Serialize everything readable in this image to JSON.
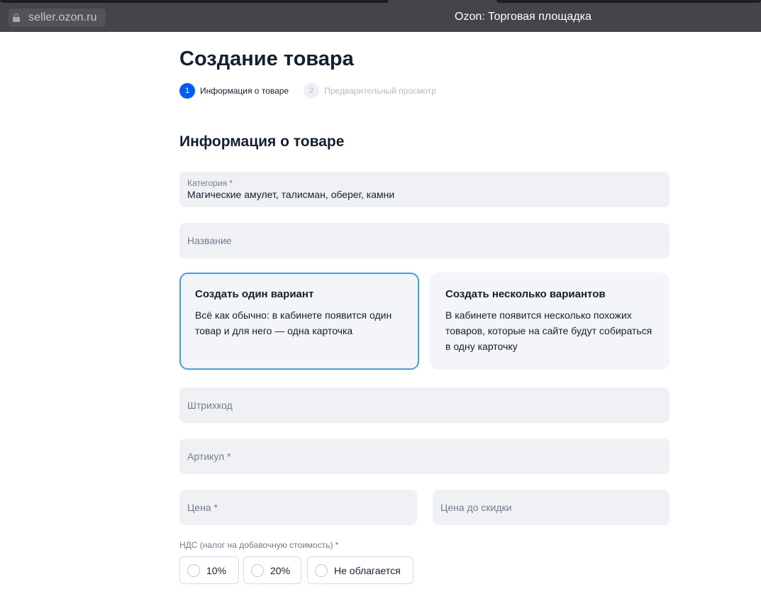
{
  "browser": {
    "url": "seller.ozon.ru",
    "window_title": "Ozon: Торговая площадка"
  },
  "page": {
    "title": "Создание товара",
    "steps": [
      {
        "number": "1",
        "label": "Информация о товаре",
        "active": true
      },
      {
        "number": "2",
        "label": "Предварительный просмотр",
        "active": false
      }
    ],
    "section_title": "Информация о товаре"
  },
  "form": {
    "category": {
      "label": "Категория *",
      "value": "Магические амулет, талисман, оберег, камни"
    },
    "name": {
      "placeholder": "Название"
    },
    "variants": [
      {
        "title": "Создать один вариант",
        "description": "Всё как обычно: в кабинете появится один товар и для него — одна карточка",
        "selected": true
      },
      {
        "title": "Создать несколько вариантов",
        "description": "В кабинете появится несколько похожих товаров, которые на сайте будут собираться в одну карточку",
        "selected": false
      }
    ],
    "barcode": {
      "placeholder": "Штрихкод"
    },
    "article": {
      "placeholder": "Артикул *"
    },
    "price": {
      "placeholder": "Цена *"
    },
    "old_price": {
      "placeholder": "Цена до скидки"
    },
    "vat": {
      "label": "НДС (налог на добавочную стоимость) *",
      "options": [
        "10%",
        "20%",
        "Не облагается"
      ]
    }
  },
  "colors": {
    "accent": "#005bff",
    "selected_border": "#4a9be0",
    "field_bg": "#eff1f5"
  }
}
